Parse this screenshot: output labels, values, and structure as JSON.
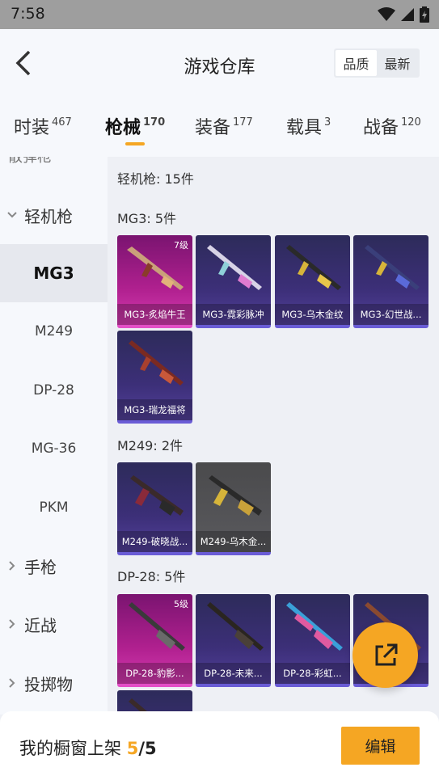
{
  "status_bar": {
    "time": "7:58"
  },
  "header": {
    "title": "游戏仓库",
    "sort_options": [
      "品质",
      "最新"
    ],
    "active_sort": "品质"
  },
  "tabs": [
    {
      "label": "时装",
      "count": "467"
    },
    {
      "label": "枪械",
      "count": "170"
    },
    {
      "label": "装备",
      "count": "177"
    },
    {
      "label": "载具",
      "count": "3"
    },
    {
      "label": "战备",
      "count": "120"
    }
  ],
  "sidebar": {
    "partial_top": "散弹枪",
    "categories": {
      "lmg": "轻机枪",
      "pistol": "手枪",
      "melee": "近战",
      "throwable": "投掷物"
    },
    "subitems": [
      "MG3",
      "M249",
      "DP-28",
      "MG-36",
      "PKM"
    ]
  },
  "content": {
    "total_label": "轻机枪: 15件",
    "sections": {
      "mg3": {
        "title": "MG3: 5件",
        "items": [
          {
            "name": "MG3-炙焰牛王",
            "level": "7级"
          },
          {
            "name": "MG3-霓彩脉冲"
          },
          {
            "name": "MG3-乌木金纹"
          },
          {
            "name": "MG3-幻世战..."
          },
          {
            "name": "MG3-瑞龙福将"
          }
        ]
      },
      "m249": {
        "title": "M249: 2件",
        "items": [
          {
            "name": "M249-破晓战..."
          },
          {
            "name": "M249-乌木金..."
          }
        ]
      },
      "dp28": {
        "title": "DP-28: 5件",
        "items": [
          {
            "name": "DP-28-豹影...",
            "level": "5级"
          },
          {
            "name": "DP-28-未来..."
          },
          {
            "name": "DP-28-彩虹..."
          },
          {
            "name": "..."
          }
        ]
      }
    }
  },
  "bottom": {
    "showcase_label": "我的橱窗上架 ",
    "current": "5",
    "slash": "/",
    "total": "5",
    "edit_label": "编辑"
  },
  "colors": {
    "accent": "#f5a623",
    "purple_rarity": "#6a5cd6",
    "pink_rarity": "#e34fc6"
  }
}
